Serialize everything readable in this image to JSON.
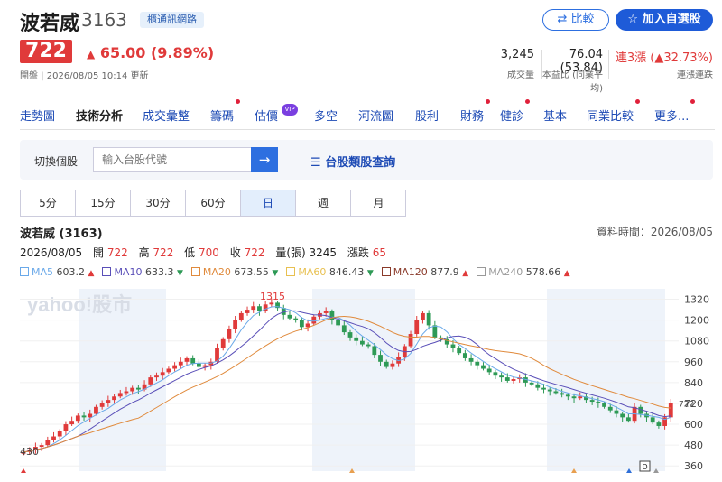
{
  "stock": {
    "name": "波若威",
    "code": "3163",
    "tag": "櫃通訊網路",
    "price": "722",
    "change": "65.00 (9.89%)",
    "change_arrow": "▲",
    "meta": "開盤 | 2026/08/05 10:14 更新"
  },
  "actions": {
    "compare": "比較",
    "add": "加入自選股",
    "compare_icon": "compare-icon",
    "star_icon": "star-icon"
  },
  "stats": [
    {
      "value": "3,245",
      "label": "成交量"
    },
    {
      "value": "76.04 (53.84)",
      "label": "本益比 (同業平均)"
    },
    {
      "value": "連3漲 (▲32.73%)",
      "label": "連漲連跌"
    }
  ],
  "tabs": [
    {
      "label": "走勢圖",
      "dot": false
    },
    {
      "label": "技術分析",
      "dot": false,
      "active": true
    },
    {
      "label": "成交彙整",
      "dot": false
    },
    {
      "label": "籌碼",
      "dot": true
    },
    {
      "label": "估價",
      "vip": "VIP"
    },
    {
      "label": "多空",
      "dot": false
    },
    {
      "label": "河流圖",
      "dot": false
    },
    {
      "label": "股利",
      "dot": false
    },
    {
      "label": "財務",
      "dot": true
    },
    {
      "label": "健診",
      "dot": true
    },
    {
      "label": "基本",
      "dot": false
    },
    {
      "label": "同業比較",
      "dot": true
    },
    {
      "label": "更多",
      "dot": true
    }
  ],
  "switcher": {
    "label": "切換個股",
    "placeholder": "輸入台股代號",
    "go_icon": "arrow-right-icon",
    "category_link": "台股類股查詢",
    "category_icon": "list-icon"
  },
  "periods": [
    "5分",
    "15分",
    "30分",
    "60分",
    "日",
    "週",
    "月"
  ],
  "active_period": "日",
  "chart_header": {
    "name": "波若威 (3163)",
    "time": "資料時間：2026/08/05",
    "date": "2026/08/05",
    "open_label": "開",
    "open": "722",
    "high_label": "高",
    "high": "722",
    "low_label": "低",
    "low": "700",
    "close_label": "收",
    "close": "722",
    "vol_label": "量(張)",
    "vol": "3245",
    "chg_label": "漲跌",
    "chg": "65"
  },
  "ma_legend": [
    {
      "name": "MA5",
      "value": "603.2",
      "dir": "▲",
      "color": "#6aa9e9"
    },
    {
      "name": "MA10",
      "value": "633.3",
      "dir": "▼",
      "color": "#5a4fb8"
    },
    {
      "name": "MA20",
      "value": "673.55",
      "dir": "▼",
      "color": "#e08a3c"
    },
    {
      "name": "MA60",
      "value": "846.43",
      "dir": "▼",
      "color": "#e8c050"
    },
    {
      "name": "MA120",
      "value": "877.9",
      "dir": "▲",
      "color": "#8a3a2a"
    },
    {
      "name": "MA240",
      "value": "578.66",
      "dir": "▲",
      "color": "#999999"
    }
  ],
  "watermark": "yahoo!股市",
  "colors": {
    "up": "#e03a3a",
    "down": "#2e9a56",
    "accent": "#2d6fe0"
  },
  "chart_data": {
    "type": "candlestick",
    "y_ticks": [
      "1320",
      "1200",
      "1080",
      "960",
      "840",
      "720",
      "600",
      "480",
      "360"
    ],
    "ylim": [
      330,
      1380
    ],
    "high_label": "1315",
    "low_label": "430",
    "last_label": "722",
    "closes": [
      440,
      450,
      470,
      480,
      510,
      530,
      560,
      600,
      620,
      650,
      640,
      660,
      700,
      720,
      740,
      760,
      780,
      790,
      810,
      800,
      830,
      870,
      880,
      900,
      920,
      940,
      960,
      980,
      950,
      930,
      940,
      960,
      1040,
      1090,
      1150,
      1200,
      1240,
      1260,
      1280,
      1250,
      1290,
      1300,
      1270,
      1230,
      1210,
      1200,
      1160,
      1180,
      1220,
      1240,
      1250,
      1200,
      1170,
      1130,
      1100,
      1080,
      1060,
      1050,
      1000,
      960,
      930,
      950,
      990,
      1050,
      1120,
      1200,
      1240,
      1170,
      1100,
      1090,
      1060,
      1040,
      1010,
      980,
      960,
      940,
      920,
      900,
      880,
      870,
      850,
      860,
      870,
      840,
      830,
      810,
      800,
      790,
      780,
      770,
      760,
      750,
      760,
      740,
      730,
      720,
      700,
      680,
      660,
      640,
      620,
      700,
      660,
      640,
      610,
      590,
      640,
      722
    ]
  }
}
